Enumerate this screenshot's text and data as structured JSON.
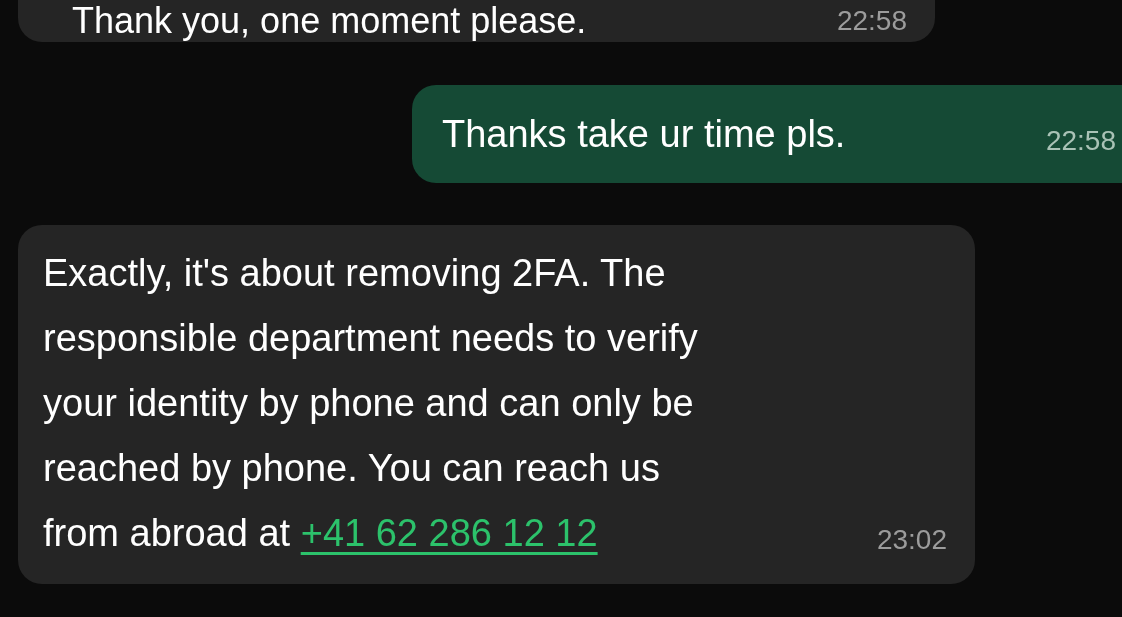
{
  "messages": [
    {
      "kind": "incoming",
      "lines": [
        "Thank you, one moment please."
      ],
      "time": "22:58"
    },
    {
      "kind": "outgoing",
      "lines": [
        "Thanks take ur time pls."
      ],
      "time": "22:58"
    },
    {
      "kind": "incoming",
      "lines": [
        "Exactly, it's about removing 2FA. The",
        "responsible department needs to verify",
        "your identity by phone and can only be",
        "reached by phone. You can reach us",
        "from abroad at"
      ],
      "link": "+41 62 286 12 12",
      "time": "23:02"
    }
  ]
}
